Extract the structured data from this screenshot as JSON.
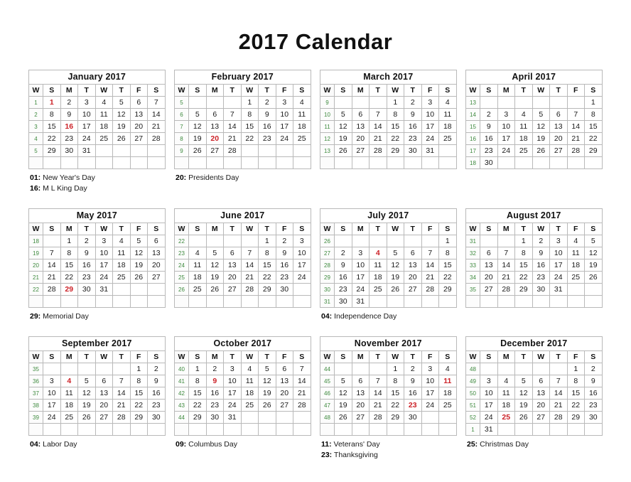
{
  "page": {
    "title": "2017 Calendar",
    "year": "2017"
  },
  "colors": {
    "holiday": "#cc2127",
    "week_number": "#3e8a3e",
    "text": "#1a1a1a",
    "border": "#b9b9b9",
    "background": "#ffffff"
  },
  "weekday_headers": [
    "W",
    "S",
    "M",
    "T",
    "W",
    "T",
    "F",
    "S"
  ],
  "months": [
    {
      "name": "January 2017",
      "weeks": [
        {
          "wk": "1",
          "days": [
            "1",
            "2",
            "3",
            "4",
            "5",
            "6",
            "7"
          ]
        },
        {
          "wk": "2",
          "days": [
            "8",
            "9",
            "10",
            "11",
            "12",
            "13",
            "14"
          ]
        },
        {
          "wk": "3",
          "days": [
            "15",
            "16",
            "17",
            "18",
            "19",
            "20",
            "21"
          ]
        },
        {
          "wk": "4",
          "days": [
            "22",
            "23",
            "24",
            "25",
            "26",
            "27",
            "28"
          ]
        },
        {
          "wk": "5",
          "days": [
            "29",
            "30",
            "31",
            "",
            "",
            "",
            ""
          ]
        },
        {
          "wk": "",
          "days": [
            "",
            "",
            "",
            "",
            "",
            "",
            ""
          ]
        }
      ],
      "holiday_days": [
        "1",
        "16"
      ],
      "holidays": [
        {
          "day": "01:",
          "name": "New Year's Day"
        },
        {
          "day": "16:",
          "name": "M L King Day"
        }
      ]
    },
    {
      "name": "February 2017",
      "weeks": [
        {
          "wk": "5",
          "days": [
            "",
            "",
            "",
            "1",
            "2",
            "3",
            "4"
          ]
        },
        {
          "wk": "6",
          "days": [
            "5",
            "6",
            "7",
            "8",
            "9",
            "10",
            "11"
          ]
        },
        {
          "wk": "7",
          "days": [
            "12",
            "13",
            "14",
            "15",
            "16",
            "17",
            "18"
          ]
        },
        {
          "wk": "8",
          "days": [
            "19",
            "20",
            "21",
            "22",
            "23",
            "24",
            "25"
          ]
        },
        {
          "wk": "9",
          "days": [
            "26",
            "27",
            "28",
            "",
            "",
            "",
            ""
          ]
        },
        {
          "wk": "",
          "days": [
            "",
            "",
            "",
            "",
            "",
            "",
            ""
          ]
        }
      ],
      "holiday_days": [
        "20"
      ],
      "holidays": [
        {
          "day": "20:",
          "name": "Presidents Day"
        }
      ]
    },
    {
      "name": "March 2017",
      "weeks": [
        {
          "wk": "9",
          "days": [
            "",
            "",
            "",
            "1",
            "2",
            "3",
            "4"
          ]
        },
        {
          "wk": "10",
          "days": [
            "5",
            "6",
            "7",
            "8",
            "9",
            "10",
            "11"
          ]
        },
        {
          "wk": "11",
          "days": [
            "12",
            "13",
            "14",
            "15",
            "16",
            "17",
            "18"
          ]
        },
        {
          "wk": "12",
          "days": [
            "19",
            "20",
            "21",
            "22",
            "23",
            "24",
            "25"
          ]
        },
        {
          "wk": "13",
          "days": [
            "26",
            "27",
            "28",
            "29",
            "30",
            "31",
            ""
          ]
        },
        {
          "wk": "",
          "days": [
            "",
            "",
            "",
            "",
            "",
            "",
            ""
          ]
        }
      ],
      "holiday_days": [],
      "holidays": []
    },
    {
      "name": "April 2017",
      "weeks": [
        {
          "wk": "13",
          "days": [
            "",
            "",
            "",
            "",
            "",
            "",
            "1"
          ]
        },
        {
          "wk": "14",
          "days": [
            "2",
            "3",
            "4",
            "5",
            "6",
            "7",
            "8"
          ]
        },
        {
          "wk": "15",
          "days": [
            "9",
            "10",
            "11",
            "12",
            "13",
            "14",
            "15"
          ]
        },
        {
          "wk": "16",
          "days": [
            "16",
            "17",
            "18",
            "19",
            "20",
            "21",
            "22"
          ]
        },
        {
          "wk": "17",
          "days": [
            "23",
            "24",
            "25",
            "26",
            "27",
            "28",
            "29"
          ]
        },
        {
          "wk": "18",
          "days": [
            "30",
            "",
            "",
            "",
            "",
            "",
            ""
          ]
        }
      ],
      "holiday_days": [],
      "holidays": []
    },
    {
      "name": "May 2017",
      "weeks": [
        {
          "wk": "18",
          "days": [
            "",
            "1",
            "2",
            "3",
            "4",
            "5",
            "6"
          ]
        },
        {
          "wk": "19",
          "days": [
            "7",
            "8",
            "9",
            "10",
            "11",
            "12",
            "13"
          ]
        },
        {
          "wk": "20",
          "days": [
            "14",
            "15",
            "16",
            "17",
            "18",
            "19",
            "20"
          ]
        },
        {
          "wk": "21",
          "days": [
            "21",
            "22",
            "23",
            "24",
            "25",
            "26",
            "27"
          ]
        },
        {
          "wk": "22",
          "days": [
            "28",
            "29",
            "30",
            "31",
            "",
            "",
            ""
          ]
        },
        {
          "wk": "",
          "days": [
            "",
            "",
            "",
            "",
            "",
            "",
            ""
          ]
        }
      ],
      "holiday_days": [
        "29"
      ],
      "holidays": [
        {
          "day": "29:",
          "name": "Memorial Day"
        }
      ]
    },
    {
      "name": "June 2017",
      "weeks": [
        {
          "wk": "22",
          "days": [
            "",
            "",
            "",
            "",
            "1",
            "2",
            "3"
          ]
        },
        {
          "wk": "23",
          "days": [
            "4",
            "5",
            "6",
            "7",
            "8",
            "9",
            "10"
          ]
        },
        {
          "wk": "24",
          "days": [
            "11",
            "12",
            "13",
            "14",
            "15",
            "16",
            "17"
          ]
        },
        {
          "wk": "25",
          "days": [
            "18",
            "19",
            "20",
            "21",
            "22",
            "23",
            "24"
          ]
        },
        {
          "wk": "26",
          "days": [
            "25",
            "26",
            "27",
            "28",
            "29",
            "30",
            ""
          ]
        },
        {
          "wk": "",
          "days": [
            "",
            "",
            "",
            "",
            "",
            "",
            ""
          ]
        }
      ],
      "holiday_days": [],
      "holidays": []
    },
    {
      "name": "July 2017",
      "weeks": [
        {
          "wk": "26",
          "days": [
            "",
            "",
            "",
            "",
            "",
            "",
            "1"
          ]
        },
        {
          "wk": "27",
          "days": [
            "2",
            "3",
            "4",
            "5",
            "6",
            "7",
            "8"
          ]
        },
        {
          "wk": "28",
          "days": [
            "9",
            "10",
            "11",
            "12",
            "13",
            "14",
            "15"
          ]
        },
        {
          "wk": "29",
          "days": [
            "16",
            "17",
            "18",
            "19",
            "20",
            "21",
            "22"
          ]
        },
        {
          "wk": "30",
          "days": [
            "23",
            "24",
            "25",
            "26",
            "27",
            "28",
            "29"
          ]
        },
        {
          "wk": "31",
          "days": [
            "30",
            "31",
            "",
            "",
            "",
            "",
            ""
          ]
        }
      ],
      "holiday_days": [
        "4"
      ],
      "holidays": [
        {
          "day": "04:",
          "name": "Independence Day"
        }
      ]
    },
    {
      "name": "August 2017",
      "weeks": [
        {
          "wk": "31",
          "days": [
            "",
            "",
            "1",
            "2",
            "3",
            "4",
            "5"
          ]
        },
        {
          "wk": "32",
          "days": [
            "6",
            "7",
            "8",
            "9",
            "10",
            "11",
            "12"
          ]
        },
        {
          "wk": "33",
          "days": [
            "13",
            "14",
            "15",
            "16",
            "17",
            "18",
            "19"
          ]
        },
        {
          "wk": "34",
          "days": [
            "20",
            "21",
            "22",
            "23",
            "24",
            "25",
            "26"
          ]
        },
        {
          "wk": "35",
          "days": [
            "27",
            "28",
            "29",
            "30",
            "31",
            "",
            ""
          ]
        },
        {
          "wk": "",
          "days": [
            "",
            "",
            "",
            "",
            "",
            "",
            ""
          ]
        }
      ],
      "holiday_days": [],
      "holidays": []
    },
    {
      "name": "September 2017",
      "weeks": [
        {
          "wk": "35",
          "days": [
            "",
            "",
            "",
            "",
            "",
            "1",
            "2"
          ]
        },
        {
          "wk": "36",
          "days": [
            "3",
            "4",
            "5",
            "6",
            "7",
            "8",
            "9"
          ]
        },
        {
          "wk": "37",
          "days": [
            "10",
            "11",
            "12",
            "13",
            "14",
            "15",
            "16"
          ]
        },
        {
          "wk": "38",
          "days": [
            "17",
            "18",
            "19",
            "20",
            "21",
            "22",
            "23"
          ]
        },
        {
          "wk": "39",
          "days": [
            "24",
            "25",
            "26",
            "27",
            "28",
            "29",
            "30"
          ]
        },
        {
          "wk": "",
          "days": [
            "",
            "",
            "",
            "",
            "",
            "",
            ""
          ]
        }
      ],
      "holiday_days": [
        "4"
      ],
      "holidays": [
        {
          "day": "04:",
          "name": "Labor Day"
        }
      ]
    },
    {
      "name": "October 2017",
      "weeks": [
        {
          "wk": "40",
          "days": [
            "1",
            "2",
            "3",
            "4",
            "5",
            "6",
            "7"
          ]
        },
        {
          "wk": "41",
          "days": [
            "8",
            "9",
            "10",
            "11",
            "12",
            "13",
            "14"
          ]
        },
        {
          "wk": "42",
          "days": [
            "15",
            "16",
            "17",
            "18",
            "19",
            "20",
            "21"
          ]
        },
        {
          "wk": "43",
          "days": [
            "22",
            "23",
            "24",
            "25",
            "26",
            "27",
            "28"
          ]
        },
        {
          "wk": "44",
          "days": [
            "29",
            "30",
            "31",
            "",
            "",
            "",
            ""
          ]
        },
        {
          "wk": "",
          "days": [
            "",
            "",
            "",
            "",
            "",
            "",
            ""
          ]
        }
      ],
      "holiday_days": [
        "9"
      ],
      "holidays": [
        {
          "day": "09:",
          "name": "Columbus Day"
        }
      ]
    },
    {
      "name": "November 2017",
      "weeks": [
        {
          "wk": "44",
          "days": [
            "",
            "",
            "",
            "1",
            "2",
            "3",
            "4"
          ]
        },
        {
          "wk": "45",
          "days": [
            "5",
            "6",
            "7",
            "8",
            "9",
            "10",
            "11"
          ]
        },
        {
          "wk": "46",
          "days": [
            "12",
            "13",
            "14",
            "15",
            "16",
            "17",
            "18"
          ]
        },
        {
          "wk": "47",
          "days": [
            "19",
            "20",
            "21",
            "22",
            "23",
            "24",
            "25"
          ]
        },
        {
          "wk": "48",
          "days": [
            "26",
            "27",
            "28",
            "29",
            "30",
            "",
            ""
          ]
        },
        {
          "wk": "",
          "days": [
            "",
            "",
            "",
            "",
            "",
            "",
            ""
          ]
        }
      ],
      "holiday_days": [
        "11",
        "23"
      ],
      "holidays": [
        {
          "day": "11:",
          "name": "Veterans' Day"
        },
        {
          "day": "23:",
          "name": "Thanksgiving"
        }
      ]
    },
    {
      "name": "December 2017",
      "weeks": [
        {
          "wk": "48",
          "days": [
            "",
            "",
            "",
            "",
            "",
            "1",
            "2"
          ]
        },
        {
          "wk": "49",
          "days": [
            "3",
            "4",
            "5",
            "6",
            "7",
            "8",
            "9"
          ]
        },
        {
          "wk": "50",
          "days": [
            "10",
            "11",
            "12",
            "13",
            "14",
            "15",
            "16"
          ]
        },
        {
          "wk": "51",
          "days": [
            "17",
            "18",
            "19",
            "20",
            "21",
            "22",
            "23"
          ]
        },
        {
          "wk": "52",
          "days": [
            "24",
            "25",
            "26",
            "27",
            "28",
            "29",
            "30"
          ]
        },
        {
          "wk": "1",
          "days": [
            "31",
            "",
            "",
            "",
            "",
            "",
            ""
          ]
        }
      ],
      "holiday_days": [
        "25"
      ],
      "holidays": [
        {
          "day": "25:",
          "name": "Christmas Day"
        }
      ]
    }
  ]
}
